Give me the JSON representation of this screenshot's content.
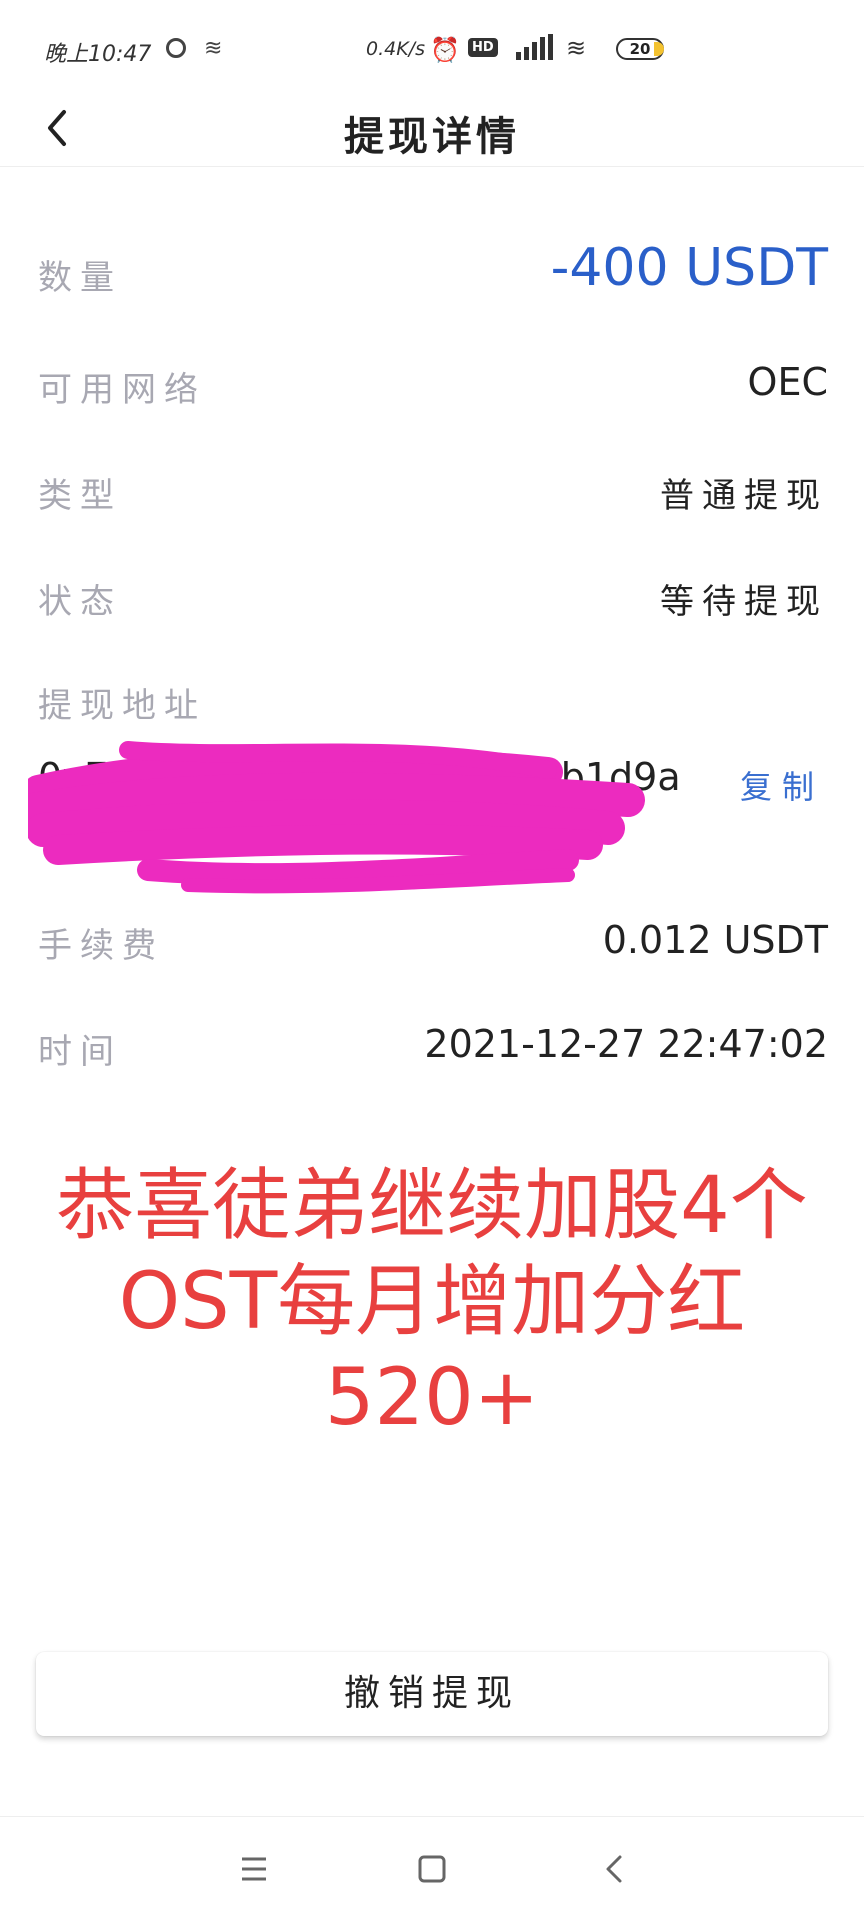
{
  "status_bar": {
    "time": "晚上10:47",
    "net_speed": "0.4K/s",
    "hd_badge": "HD",
    "battery": "20"
  },
  "header": {
    "title": "提现详情",
    "back_icon": "chevron-left-icon"
  },
  "details": {
    "amount_label": "数量",
    "amount_value": "-400 USDT",
    "network_label": "可用网络",
    "network_value": "OEC",
    "type_label": "类型",
    "type_value": "普通提现",
    "status_label": "状态",
    "status_value": "等待提现",
    "address_label": "提现地址",
    "address_line1": "0x7a2f5c1e3b9d4a6f8e2c0b1d9a3e5f73",
    "address_line2": "9cd4b18f2e6a0c3d1b7e9",
    "copy_label": "复制",
    "fee_label": "手续费",
    "fee_value": "0.012 USDT",
    "time_label": "时间",
    "time_value": "2021-12-27 22:47:02"
  },
  "promo": {
    "line1": "恭喜徒弟继续加股4个",
    "line2": "OST每月增加分红",
    "line3": "520+"
  },
  "actions": {
    "cancel_label": "撤销提现"
  },
  "colors": {
    "accent_blue": "#2a5fc9",
    "promo_red": "#e8403f",
    "label_gray": "#a8a8b2",
    "scribble_magenta": "#ec2bbf"
  },
  "navbar": {
    "menu_icon": "menu-icon",
    "home_icon": "square-home-icon",
    "back_icon": "chevron-left-icon"
  }
}
